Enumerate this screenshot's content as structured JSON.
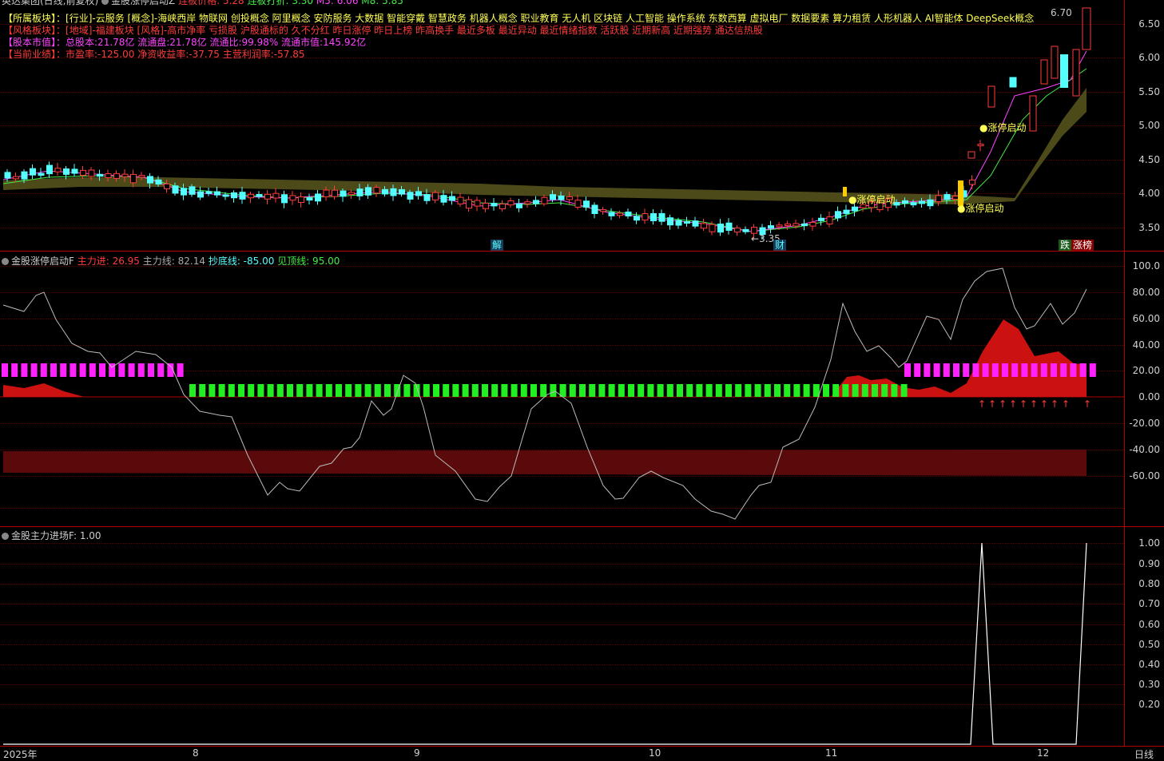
{
  "header": {
    "stock_title": "英达集团(日线,前复权)",
    "indicator1_name": "金股涨停启动Z",
    "limit_price_label": "连板价格: 5.28",
    "limit_price_text": "连板打折: 3.30",
    "ma_text": "M5: 6.06",
    "ma2_text": "M8: 5.85"
  },
  "info": {
    "sector_key": "【所属板块】：",
    "sector_val": "[行业]-云服务 [概念]-海峡西岸 物联网 创投概念 阿里概念 安防服务 大数据 智能穿戴 智慧政务 机器人概念 职业教育 无人机 区块链 人工智能 操作系统 东数西算 虚拟电厂 数据要素 算力租赁 人形机器人 AI智能体 DeepSeek概念",
    "style_key": "【风格板块】：",
    "style_val": "[地域]-福建板块 [风格]-高市净率 亏损股 沪股通标的 久不分红 昨日涨停 昨日上榜 昨高换手 最近多板 最近异动 最近情绪指数 活跃股 近期新高 近期强势 通达信热股",
    "cap_key": "【股本市值】：",
    "cap_val": "总股本:21.78亿 流通盘:21.78亿 流通比:99.98% 流通市值:145.92亿",
    "perf_key": "【当前业绩】：",
    "perf_val": "市盈率:-125.00 净资收益率:-37.75 主营利润率:-57.85"
  },
  "main_axis": [
    "6.50",
    "6.00",
    "5.50",
    "5.00",
    "4.50",
    "4.00",
    "3.50"
  ],
  "annotations": {
    "high_label": "6.70",
    "low_label": "3.35",
    "start1": "涨停启动",
    "start2": "涨停启动",
    "start3": "涨停启动",
    "mark_jie": "解",
    "mark_cai": "财",
    "mark_die": "跌",
    "mark_zhang": "涨榜"
  },
  "indicator1": {
    "title": "金股涨停启动F",
    "zljin": "主力进: 26.95",
    "zlx": "主力线: 82.14",
    "cdx": "抄底线: -85.00",
    "jdx": "见顶线: 95.00",
    "axis": [
      "100.0",
      "80.00",
      "60.00",
      "40.00",
      "20.00",
      "0.00",
      "-20.00",
      "-40.00",
      "-60.00"
    ]
  },
  "indicator2": {
    "title": "金股主力进场F",
    "value": ": 1.00",
    "axis": [
      "1.00",
      "0.90",
      "0.80",
      "0.70",
      "0.60",
      "0.50",
      "0.40",
      "0.30",
      "0.20"
    ]
  },
  "xaxis": {
    "labels": [
      "2025年",
      "8",
      "9",
      "10",
      "11",
      "12"
    ],
    "period": "日线"
  },
  "colors": {
    "up": "#ff3c3c",
    "down": "#54ffff",
    "band": "#4d4a1a",
    "grid": "#5a0000",
    "magenta": "#ff22ff",
    "green": "#22ee22"
  }
}
